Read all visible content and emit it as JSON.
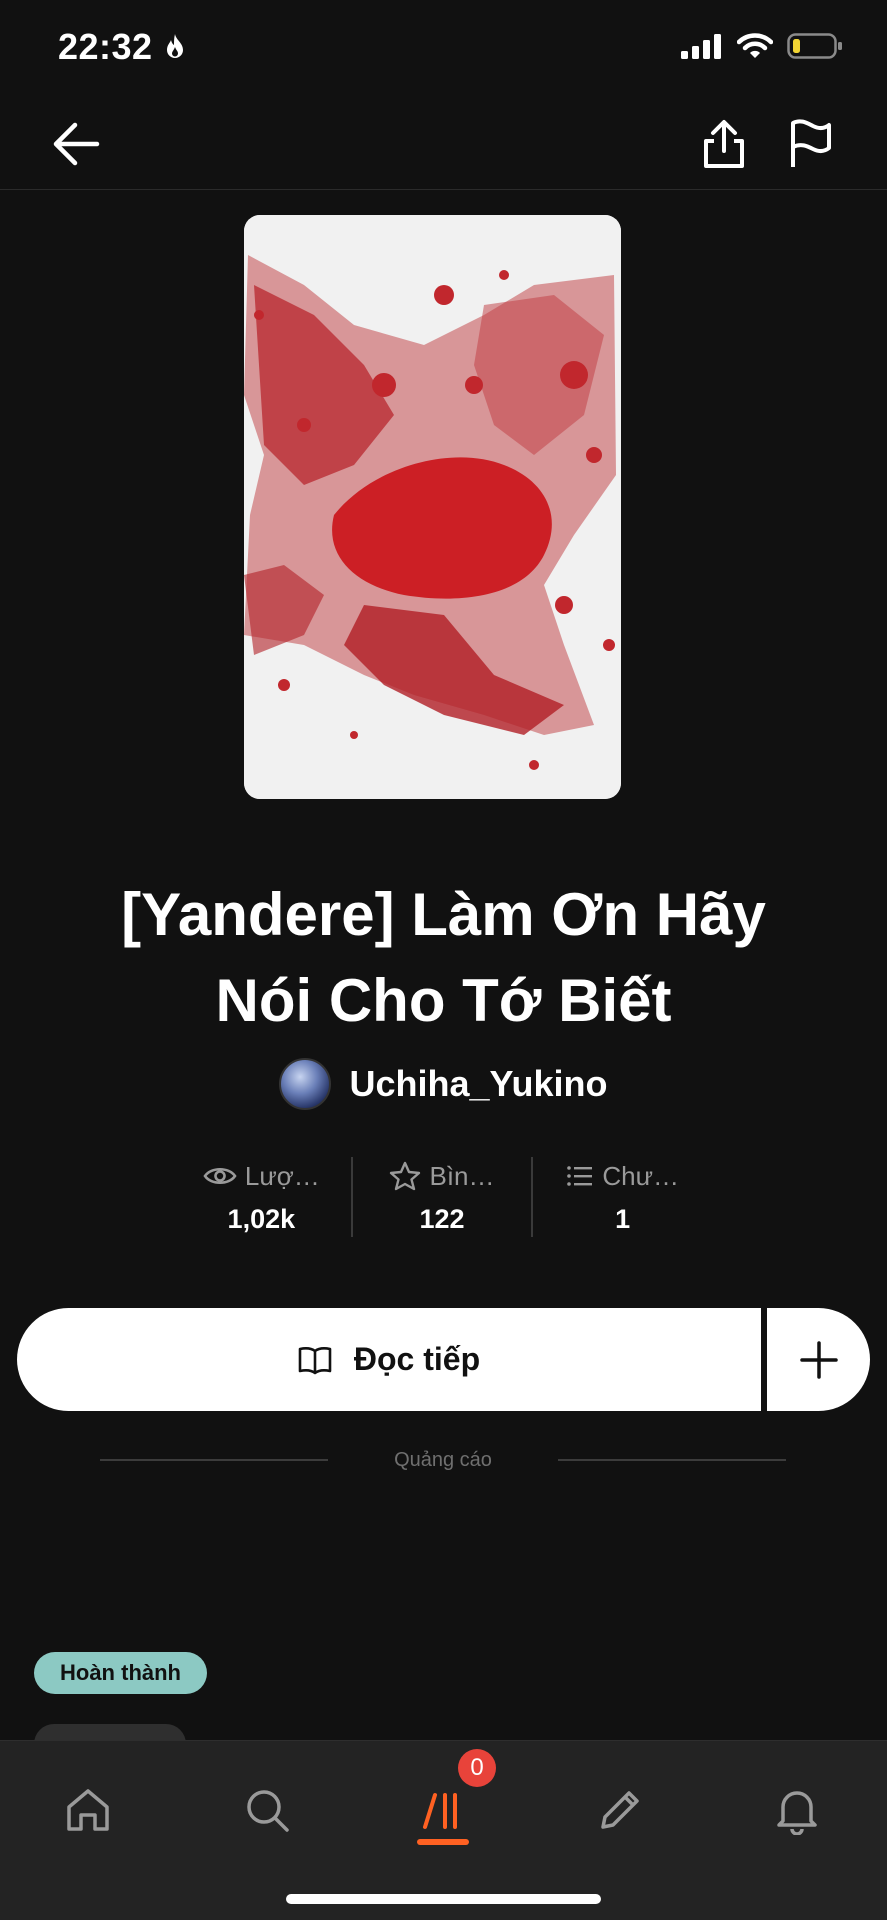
{
  "status_bar": {
    "time": "22:32"
  },
  "story": {
    "title_line1": "[Yandere] Làm Ơn Hãy",
    "title_line2": "Nói Cho Tớ Biết",
    "author": "Uchiha_Yukino"
  },
  "stats": [
    {
      "label": "Lượ…",
      "value": "1,02k",
      "icon": "eye-icon"
    },
    {
      "label": "Bìn…",
      "value": "122",
      "icon": "star-icon"
    },
    {
      "label": "Chư…",
      "value": "1",
      "icon": "list-icon"
    }
  ],
  "actions": {
    "read_label": "Đọc tiếp"
  },
  "ad": {
    "label": "Quảng cáo"
  },
  "tags": {
    "status": "Hoàn thành"
  },
  "tab_bar": {
    "library_badge": "0",
    "active_color": "#ff6122"
  },
  "colors": {
    "accent": "#ff6122",
    "badge": "#e8433a",
    "tag": "#8cc9c3"
  }
}
